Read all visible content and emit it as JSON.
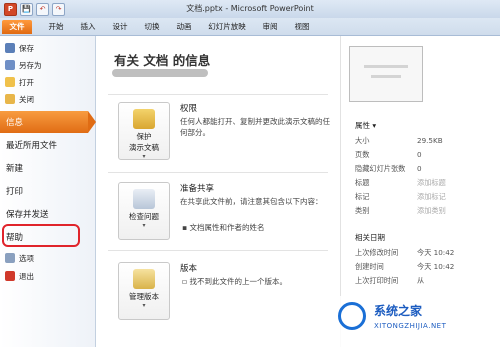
{
  "window": {
    "title": "文档.pptx - Microsoft PowerPoint",
    "qat": [
      "P",
      "💾",
      "↶",
      "↷"
    ]
  },
  "ribbon_tabs": [
    "文件",
    "开始",
    "插入",
    "设计",
    "切换",
    "动画",
    "幻灯片放映",
    "审阅",
    "视图"
  ],
  "sidebar": {
    "items": [
      {
        "label": "保存",
        "type": "small",
        "icon": "save-icon"
      },
      {
        "label": "另存为",
        "type": "small",
        "icon": "save-as-icon"
      },
      {
        "label": "打开",
        "type": "small",
        "icon": "open-folder-icon"
      },
      {
        "label": "关闭",
        "type": "small",
        "icon": "close-file-icon"
      },
      {
        "label": "信息",
        "type": "big",
        "selected": true
      },
      {
        "label": "最近所用文件",
        "type": "big"
      },
      {
        "label": "新建",
        "type": "big"
      },
      {
        "label": "打印",
        "type": "big"
      },
      {
        "label": "保存并发送",
        "type": "big"
      },
      {
        "label": "帮助",
        "type": "big",
        "highlighted": true
      },
      {
        "label": "选项",
        "type": "small",
        "icon": "options-icon"
      },
      {
        "label": "退出",
        "type": "small",
        "icon": "exit-icon"
      }
    ]
  },
  "main": {
    "heading": "有关 文档 的信息",
    "sections": [
      {
        "button": "保护\n演示文稿",
        "title": "权限",
        "desc": "任何人都能打开、复制并更改此演示文稿的任何部分。",
        "bullet": ""
      },
      {
        "button": "检查问题",
        "title": "准备共享",
        "desc": "在共享此文件前，请注意其包含以下内容：",
        "bullet": "文档属性和作者的姓名"
      },
      {
        "button": "管理版本",
        "title": "版本",
        "desc": "找不到此文件的上一个版本。",
        "bullet": ""
      }
    ]
  },
  "properties": {
    "header": "属性",
    "rows": [
      {
        "key": "大小",
        "value": "29.5KB",
        "dim": false
      },
      {
        "key": "页数",
        "value": "0",
        "dim": false
      },
      {
        "key": "隐藏幻灯片张数",
        "value": "0",
        "dim": false
      },
      {
        "key": "标题",
        "value": "添加标题",
        "dim": true
      },
      {
        "key": "标记",
        "value": "添加标记",
        "dim": true
      },
      {
        "key": "类别",
        "value": "添加类别",
        "dim": true
      }
    ],
    "dates_header": "相关日期",
    "dates": [
      {
        "key": "上次修改时间",
        "value": "今天 10:42"
      },
      {
        "key": "创建时间",
        "value": "今天 10:42"
      },
      {
        "key": "上次打印时间",
        "value": "从"
      }
    ]
  },
  "watermark": {
    "name": "系统之家",
    "url": "XITONGZHIJIA.NET"
  },
  "colors": {
    "file_tab": "#e06c14",
    "selected": "#f0801e",
    "highlight": "#e0242b"
  }
}
